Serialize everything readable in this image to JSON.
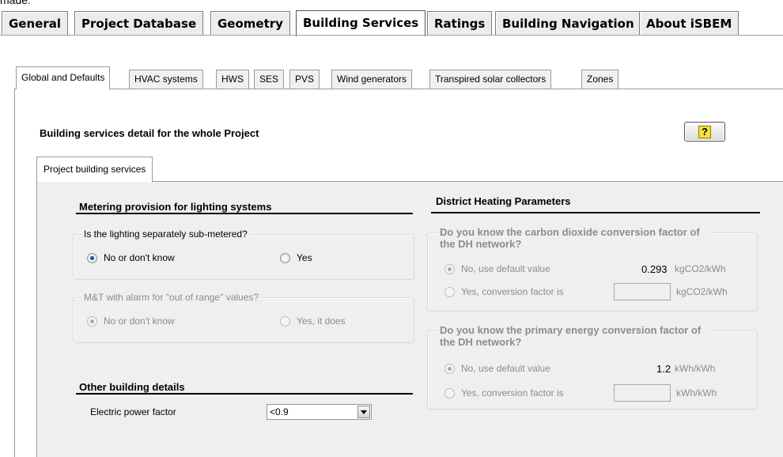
{
  "top_cut_text": "made.",
  "main_tabs": [
    "General",
    "Project Database",
    "Geometry",
    "Building Services",
    "Ratings",
    "Building Navigation",
    "About iSBEM"
  ],
  "sub_tabs": [
    "Global and Defaults",
    "HVAC systems",
    "HWS",
    "SES",
    "PVS",
    "Wind generators",
    "Transpired solar collectors",
    "Zones"
  ],
  "section_title": "Building services detail for the whole Project",
  "help_icon_glyph": "?",
  "inner_tab": "Project building services",
  "metering": {
    "heading": "Metering provision for lighting systems",
    "q1": {
      "label": "Is the lighting separately sub-metered?",
      "opt1": "No or don't know",
      "opt2": "Yes",
      "selected": "opt1"
    },
    "q2": {
      "label": "M&T with alarm for \"out of range\" values?",
      "opt1": "No or don't know",
      "opt2": "Yes, it does",
      "selected": "opt1"
    }
  },
  "other": {
    "heading": "Other building details",
    "power_factor_label": "Electric power factor",
    "power_factor_value": "<0.9"
  },
  "district": {
    "heading": "District Heating Parameters",
    "co2": {
      "label": "Do you know the carbon dioxide conversion factor of the DH network?",
      "opt1": "No, use default value",
      "default_value": "0.293",
      "unit": "kgCO2/kWh",
      "opt2": "Yes, conversion factor is",
      "unit2": "kgCO2/kWh"
    },
    "pe": {
      "label": "Do you know the primary energy conversion factor of the DH network?",
      "opt1": "No, use default value",
      "default_value": "1.2",
      "unit": "kWh/kWh",
      "opt2": "Yes, conversion factor is",
      "unit2": "kWh/kWh"
    }
  }
}
